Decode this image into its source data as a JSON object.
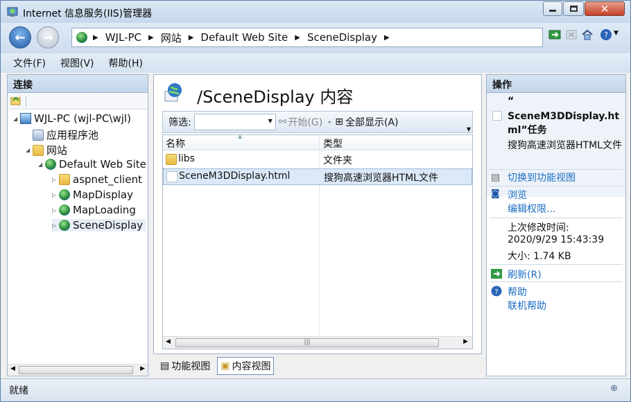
{
  "window": {
    "title": "Internet 信息服务(IIS)管理器"
  },
  "address": {
    "segments": [
      "WJL-PC",
      "网站",
      "Default Web Site",
      "SceneDisplay"
    ]
  },
  "menu": {
    "file": "文件(F)",
    "view": "视图(V)",
    "help": "帮助(H)"
  },
  "connections": {
    "header": "连接",
    "tree": [
      {
        "label": "WJL-PC (wjl-PC\\wjl)"
      },
      {
        "label": "应用程序池"
      },
      {
        "label": "网站"
      },
      {
        "label": "Default Web Site"
      },
      {
        "label": "aspnet_client"
      },
      {
        "label": "MapDisplay"
      },
      {
        "label": "MapLoading"
      },
      {
        "label": "SceneDisplay"
      }
    ]
  },
  "content": {
    "title": "/SceneDisplay 内容",
    "filter_label": "筛选:",
    "start_label": "开始(G)",
    "show_all_label": "全部显示(A)",
    "columns": [
      "名称",
      "类型"
    ],
    "rows": [
      {
        "name": "libs",
        "type": "文件夹"
      },
      {
        "name": "SceneM3DDisplay.html",
        "type": "搜狗高速浏览器HTML文件"
      }
    ],
    "tabs": {
      "features": "功能视图",
      "content": "内容视图"
    }
  },
  "actions": {
    "header": "操作",
    "quote": "“",
    "selected_name": "SceneM3DDisplay.html”任务",
    "selected_type": "搜狗高速浏览器HTML文件",
    "switch": "切换到功能视图",
    "browse": "浏览",
    "edit_perms": "编辑权限...",
    "modified_label": "上次修改时间:",
    "modified_value": "2020/9/29 15:43:39",
    "size": "大小: 1.74 KB",
    "refresh": "刷新(R)",
    "help": "帮助",
    "online_help": "联机帮助"
  },
  "status": {
    "text": "就绪"
  }
}
